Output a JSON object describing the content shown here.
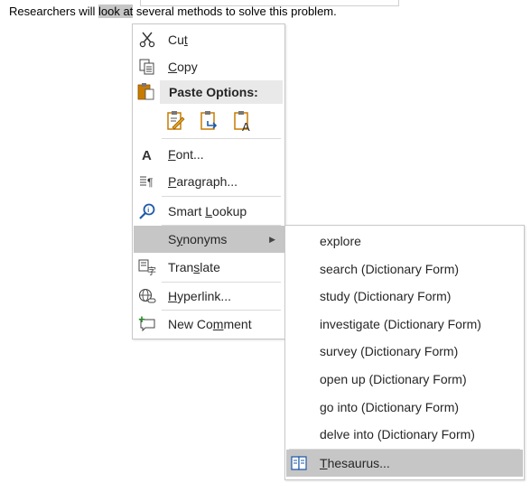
{
  "document": {
    "before": "Researchers will ",
    "selected": "look at",
    "after": " several methods to solve this problem."
  },
  "context_menu": {
    "cut": {
      "pre": "Cu",
      "key": "t",
      "post": "",
      "icon": "scissors-icon"
    },
    "copy": {
      "pre": "",
      "key": "C",
      "post": "opy",
      "icon": "copy-icon"
    },
    "paste_options": {
      "label": "Paste Options:",
      "icon": "clipboard-icon",
      "options": [
        "keep-source-formatting-icon",
        "merge-formatting-icon",
        "keep-text-only-icon"
      ]
    },
    "font": {
      "pre": "",
      "key": "F",
      "post": "ont...",
      "icon": "font-icon"
    },
    "paragraph": {
      "pre": "",
      "key": "P",
      "post": "aragraph...",
      "icon": "paragraph-icon"
    },
    "smart_lookup": {
      "pre": "Smart ",
      "key": "L",
      "post": "ookup",
      "icon": "smart-lookup-icon"
    },
    "synonyms": {
      "pre": "S",
      "key": "y",
      "post": "nonyms",
      "arrow": "▶"
    },
    "translate": {
      "pre": "Tran",
      "key": "s",
      "post": "late",
      "icon": "translate-icon"
    },
    "hyperlink": {
      "pre": "",
      "key": "H",
      "post": "yperlink...",
      "icon": "globe-link-icon"
    },
    "new_comment": {
      "pre": "New Co",
      "key": "m",
      "post": "ment",
      "icon": "new-comment-icon"
    }
  },
  "synonyms_menu": {
    "items": [
      "explore",
      "search (Dictionary Form)",
      "study (Dictionary Form)",
      "investigate (Dictionary Form)",
      "survey (Dictionary Form)",
      "open up (Dictionary Form)",
      "go into (Dictionary Form)",
      "delve into (Dictionary Form)"
    ],
    "thesaurus": {
      "pre": "",
      "key": "T",
      "post": "hesaurus...",
      "icon": "book-icon"
    }
  },
  "colors": {
    "hover": "#c6c6c6",
    "accent_blue": "#1e5aa8",
    "paste_orange": "#c97a00"
  }
}
